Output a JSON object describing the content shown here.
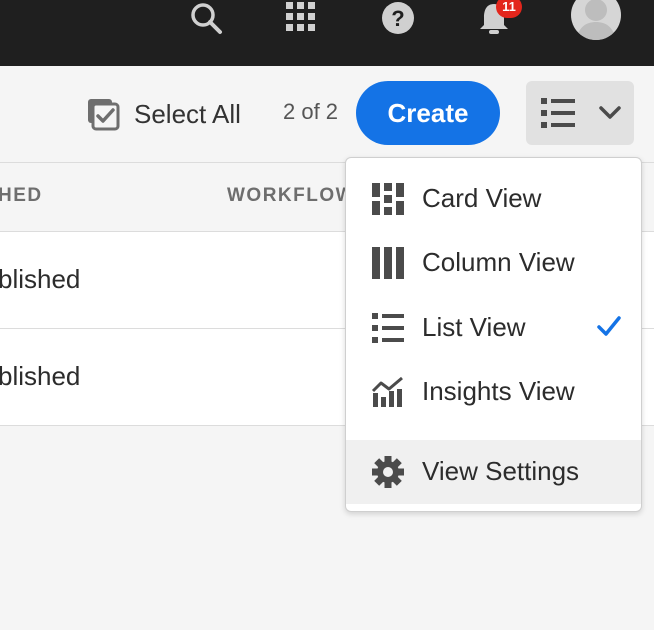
{
  "shell": {
    "notification_count": "11",
    "icons": [
      "search-icon",
      "apps-grid-icon",
      "help-icon",
      "bell-icon",
      "avatar"
    ]
  },
  "actionbar": {
    "select_all_label": "Select All",
    "selection_count": "2 of 2",
    "create_label": "Create",
    "view_toggle_icon": "list-view-icon"
  },
  "table": {
    "columns": [
      "HED",
      "WORKFLOW"
    ],
    "rows": [
      {
        "status": "blished"
      },
      {
        "status": "blished"
      }
    ]
  },
  "view_menu": {
    "items": [
      {
        "label": "Card View",
        "icon": "card-view-icon",
        "checked": false
      },
      {
        "label": "Column View",
        "icon": "column-view-icon",
        "checked": false
      },
      {
        "label": "List View",
        "icon": "list-view-icon",
        "checked": true
      },
      {
        "label": "Insights View",
        "icon": "insights-view-icon",
        "checked": false
      },
      {
        "label": "View Settings",
        "icon": "gear-icon",
        "checked": false
      }
    ]
  },
  "colors": {
    "shell_bg": "#1f1f1f",
    "accent": "#1473e6",
    "badge": "#e3261c",
    "check": "#1473e6"
  }
}
